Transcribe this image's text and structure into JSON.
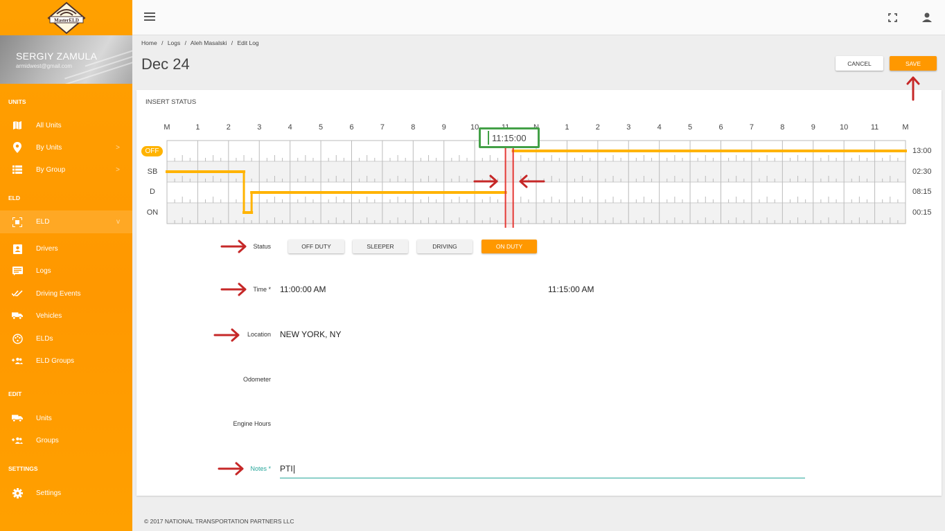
{
  "brand": {
    "logo_text": "MasterELD",
    "accent": "#ff9800",
    "selection": "#43a047",
    "marker": "#e53935"
  },
  "profile": {
    "name": "SERGIY ZAMULA",
    "email": "armidwest@gmail.com"
  },
  "sidebar": {
    "sections": [
      {
        "label": "UNITS",
        "items": [
          {
            "label": "All Units",
            "icon": "map-icon"
          },
          {
            "label": "By Units",
            "icon": "location-pin-icon",
            "chevron": ">"
          },
          {
            "label": "By Group",
            "icon": "list-icon",
            "chevron": ">"
          }
        ]
      },
      {
        "label": "ELD",
        "items": [
          {
            "label": "ELD",
            "icon": "eld-icon",
            "chevron": "v",
            "active": true
          },
          {
            "label": "Drivers",
            "icon": "badge-icon"
          },
          {
            "label": "Logs",
            "icon": "logs-icon"
          },
          {
            "label": "Driving Events",
            "icon": "double-check-icon"
          },
          {
            "label": "Vehicles",
            "icon": "truck-icon"
          },
          {
            "label": "ELDs",
            "icon": "device-icon"
          },
          {
            "label": "ELD Groups",
            "icon": "group-add-icon"
          }
        ]
      },
      {
        "label": "EDIT",
        "items": [
          {
            "label": "Units",
            "icon": "truck-icon"
          },
          {
            "label": "Groups",
            "icon": "group-add-icon"
          }
        ]
      },
      {
        "label": "SETTINGS",
        "items": [
          {
            "label": "Settings",
            "icon": "gear-icon"
          }
        ]
      }
    ]
  },
  "topbar": {
    "menu_icon": "hamburger-icon",
    "fullscreen_icon": "fullscreen-icon",
    "account_icon": "account-icon"
  },
  "breadcrumb": [
    "Home",
    "/",
    "Logs",
    "/",
    "Aleh Masalski",
    "/",
    "Edit Log"
  ],
  "page": {
    "title": "Dec 24",
    "cancel_label": "CANCEL",
    "save_label": "SAVE"
  },
  "card": {
    "title": "INSERT STATUS"
  },
  "log_chart": {
    "hour_labels": [
      "M",
      "1",
      "2",
      "3",
      "4",
      "5",
      "6",
      "7",
      "8",
      "9",
      "10",
      "11",
      "N",
      "1",
      "2",
      "3",
      "4",
      "5",
      "6",
      "7",
      "8",
      "9",
      "10",
      "11",
      "M"
    ],
    "statuses": [
      "OFF",
      "SB",
      "D",
      "ON"
    ],
    "totals": [
      "13:00",
      "02:30",
      "08:15",
      "00:15"
    ],
    "segments": [
      {
        "status": "SB",
        "start": 0,
        "end": 2.5
      },
      {
        "status": "ON",
        "start": 2.5,
        "end": 2.75
      },
      {
        "status": "D",
        "start": 2.75,
        "end": 11.0
      },
      {
        "status": "OFF",
        "start": 11.25,
        "end": 24.0
      }
    ],
    "selection": {
      "start": 11.0,
      "end": 11.25
    },
    "selection_label": "11:15:00"
  },
  "form": {
    "status_label": "Status",
    "status_options": [
      {
        "label": "OFF DUTY",
        "active": false
      },
      {
        "label": "SLEEPER",
        "active": false
      },
      {
        "label": "DRIVING",
        "active": false
      },
      {
        "label": "ON DUTY",
        "active": true
      }
    ],
    "time_label": "Time *",
    "time_start": "11:00:00 AM",
    "time_end": "11:15:00 AM",
    "location_label": "Location",
    "location_value": "NEW YORK, NY",
    "odometer_label": "Odometer",
    "engine_hours_label": "Engine Hours",
    "notes_label": "Notes *",
    "notes_value": "PTI"
  },
  "footer": {
    "text": "© 2017 NATIONAL TRANSPORTATION PARTNERS LLC"
  }
}
